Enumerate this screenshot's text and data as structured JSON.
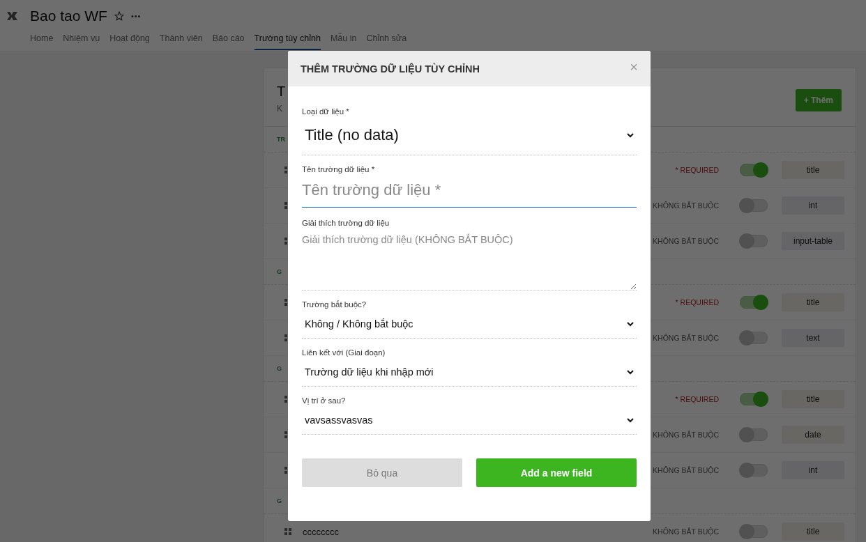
{
  "header": {
    "title": "Bao tao WF",
    "more": "•••"
  },
  "tabs": [
    {
      "label": "Home",
      "selected": false
    },
    {
      "label": "Nhiệm vụ",
      "selected": false
    },
    {
      "label": "Hoạt động",
      "selected": false
    },
    {
      "label": "Thành viên",
      "selected": false
    },
    {
      "label": "Báo cáo",
      "selected": false
    },
    {
      "label": "Trường tùy chỉnh",
      "selected": true
    },
    {
      "label": "Mẫu in",
      "selected": false
    },
    {
      "label": "Chỉnh sửa",
      "selected": false
    }
  ],
  "card": {
    "title": "T",
    "subtitle": "K",
    "add_button": "+ Thêm",
    "groups": [
      {
        "header": "TR",
        "rows": [
          {
            "status": "* REQUIRED",
            "required": true,
            "on": true,
            "type": "title"
          },
          {
            "status": "KHÔNG BẮT BUỘC",
            "required": false,
            "on": false,
            "type": "int"
          },
          {
            "status": "KHÔNG BẮT BUỘC",
            "required": false,
            "on": false,
            "type": "input-table"
          }
        ]
      },
      {
        "header": "G",
        "rows": [
          {
            "status": "* REQUIRED",
            "required": true,
            "on": true,
            "type": "title"
          },
          {
            "status": "KHÔNG BẮT BUỘC",
            "required": false,
            "on": false,
            "type": "text"
          }
        ]
      },
      {
        "header": "G",
        "rows": [
          {
            "status": "* REQUIRED",
            "required": true,
            "on": true,
            "type": "title"
          },
          {
            "status": "KHÔNG BẮT BUỘC",
            "required": false,
            "on": false,
            "type": "date"
          },
          {
            "status": "KHÔNG BẮT BUỘC",
            "required": false,
            "on": false,
            "type": "int"
          }
        ]
      },
      {
        "header": "G",
        "rows": [
          {
            "name": "cccccccc",
            "status": "KHÔNG BẮT BUỘC",
            "required": false,
            "on": false,
            "type": "title"
          }
        ]
      }
    ]
  },
  "modal": {
    "title": "THÊM TRƯỜNG DỮ LIỆU TÙY CHỈNH",
    "close": "×",
    "fields": [
      {
        "kind": "bigselect",
        "label": "Loại dữ liệu *",
        "value": "Title (no data)"
      },
      {
        "kind": "input",
        "label": "Tên trường dữ liệu *",
        "placeholder": "Tên trường dữ liệu *"
      },
      {
        "kind": "textarea",
        "label": "Giải thích trường dữ liệu",
        "placeholder": "Giải thích trường dữ liệu (KHÔNG BẮT BUỘC)"
      },
      {
        "kind": "select",
        "label": "Trường bắt buộc?",
        "value": "Không / Không bắt buộc"
      },
      {
        "kind": "select",
        "label": "Liên kết với (Giai đoạn)",
        "value": "Trường dữ liệu khi nhập mới"
      },
      {
        "kind": "select",
        "label": "Vị trí ở sau?",
        "value": "vavsassvasvas"
      }
    ],
    "cancel": "Bỏ qua",
    "submit": "Add a new field"
  }
}
